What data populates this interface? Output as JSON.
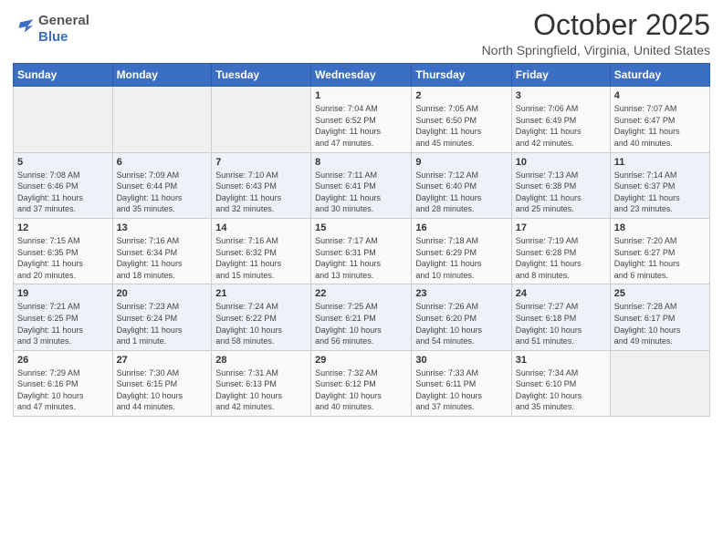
{
  "logo": {
    "general": "General",
    "blue": "Blue"
  },
  "header": {
    "title": "October 2025",
    "subtitle": "North Springfield, Virginia, United States"
  },
  "calendar": {
    "headers": [
      "Sunday",
      "Monday",
      "Tuesday",
      "Wednesday",
      "Thursday",
      "Friday",
      "Saturday"
    ],
    "weeks": [
      [
        {
          "day": "",
          "info": ""
        },
        {
          "day": "",
          "info": ""
        },
        {
          "day": "",
          "info": ""
        },
        {
          "day": "1",
          "info": "Sunrise: 7:04 AM\nSunset: 6:52 PM\nDaylight: 11 hours\nand 47 minutes."
        },
        {
          "day": "2",
          "info": "Sunrise: 7:05 AM\nSunset: 6:50 PM\nDaylight: 11 hours\nand 45 minutes."
        },
        {
          "day": "3",
          "info": "Sunrise: 7:06 AM\nSunset: 6:49 PM\nDaylight: 11 hours\nand 42 minutes."
        },
        {
          "day": "4",
          "info": "Sunrise: 7:07 AM\nSunset: 6:47 PM\nDaylight: 11 hours\nand 40 minutes."
        }
      ],
      [
        {
          "day": "5",
          "info": "Sunrise: 7:08 AM\nSunset: 6:46 PM\nDaylight: 11 hours\nand 37 minutes."
        },
        {
          "day": "6",
          "info": "Sunrise: 7:09 AM\nSunset: 6:44 PM\nDaylight: 11 hours\nand 35 minutes."
        },
        {
          "day": "7",
          "info": "Sunrise: 7:10 AM\nSunset: 6:43 PM\nDaylight: 11 hours\nand 32 minutes."
        },
        {
          "day": "8",
          "info": "Sunrise: 7:11 AM\nSunset: 6:41 PM\nDaylight: 11 hours\nand 30 minutes."
        },
        {
          "day": "9",
          "info": "Sunrise: 7:12 AM\nSunset: 6:40 PM\nDaylight: 11 hours\nand 28 minutes."
        },
        {
          "day": "10",
          "info": "Sunrise: 7:13 AM\nSunset: 6:38 PM\nDaylight: 11 hours\nand 25 minutes."
        },
        {
          "day": "11",
          "info": "Sunrise: 7:14 AM\nSunset: 6:37 PM\nDaylight: 11 hours\nand 23 minutes."
        }
      ],
      [
        {
          "day": "12",
          "info": "Sunrise: 7:15 AM\nSunset: 6:35 PM\nDaylight: 11 hours\nand 20 minutes."
        },
        {
          "day": "13",
          "info": "Sunrise: 7:16 AM\nSunset: 6:34 PM\nDaylight: 11 hours\nand 18 minutes."
        },
        {
          "day": "14",
          "info": "Sunrise: 7:16 AM\nSunset: 6:32 PM\nDaylight: 11 hours\nand 15 minutes."
        },
        {
          "day": "15",
          "info": "Sunrise: 7:17 AM\nSunset: 6:31 PM\nDaylight: 11 hours\nand 13 minutes."
        },
        {
          "day": "16",
          "info": "Sunrise: 7:18 AM\nSunset: 6:29 PM\nDaylight: 11 hours\nand 10 minutes."
        },
        {
          "day": "17",
          "info": "Sunrise: 7:19 AM\nSunset: 6:28 PM\nDaylight: 11 hours\nand 8 minutes."
        },
        {
          "day": "18",
          "info": "Sunrise: 7:20 AM\nSunset: 6:27 PM\nDaylight: 11 hours\nand 6 minutes."
        }
      ],
      [
        {
          "day": "19",
          "info": "Sunrise: 7:21 AM\nSunset: 6:25 PM\nDaylight: 11 hours\nand 3 minutes."
        },
        {
          "day": "20",
          "info": "Sunrise: 7:23 AM\nSunset: 6:24 PM\nDaylight: 11 hours\nand 1 minute."
        },
        {
          "day": "21",
          "info": "Sunrise: 7:24 AM\nSunset: 6:22 PM\nDaylight: 10 hours\nand 58 minutes."
        },
        {
          "day": "22",
          "info": "Sunrise: 7:25 AM\nSunset: 6:21 PM\nDaylight: 10 hours\nand 56 minutes."
        },
        {
          "day": "23",
          "info": "Sunrise: 7:26 AM\nSunset: 6:20 PM\nDaylight: 10 hours\nand 54 minutes."
        },
        {
          "day": "24",
          "info": "Sunrise: 7:27 AM\nSunset: 6:18 PM\nDaylight: 10 hours\nand 51 minutes."
        },
        {
          "day": "25",
          "info": "Sunrise: 7:28 AM\nSunset: 6:17 PM\nDaylight: 10 hours\nand 49 minutes."
        }
      ],
      [
        {
          "day": "26",
          "info": "Sunrise: 7:29 AM\nSunset: 6:16 PM\nDaylight: 10 hours\nand 47 minutes."
        },
        {
          "day": "27",
          "info": "Sunrise: 7:30 AM\nSunset: 6:15 PM\nDaylight: 10 hours\nand 44 minutes."
        },
        {
          "day": "28",
          "info": "Sunrise: 7:31 AM\nSunset: 6:13 PM\nDaylight: 10 hours\nand 42 minutes."
        },
        {
          "day": "29",
          "info": "Sunrise: 7:32 AM\nSunset: 6:12 PM\nDaylight: 10 hours\nand 40 minutes."
        },
        {
          "day": "30",
          "info": "Sunrise: 7:33 AM\nSunset: 6:11 PM\nDaylight: 10 hours\nand 37 minutes."
        },
        {
          "day": "31",
          "info": "Sunrise: 7:34 AM\nSunset: 6:10 PM\nDaylight: 10 hours\nand 35 minutes."
        },
        {
          "day": "",
          "info": ""
        }
      ]
    ]
  }
}
